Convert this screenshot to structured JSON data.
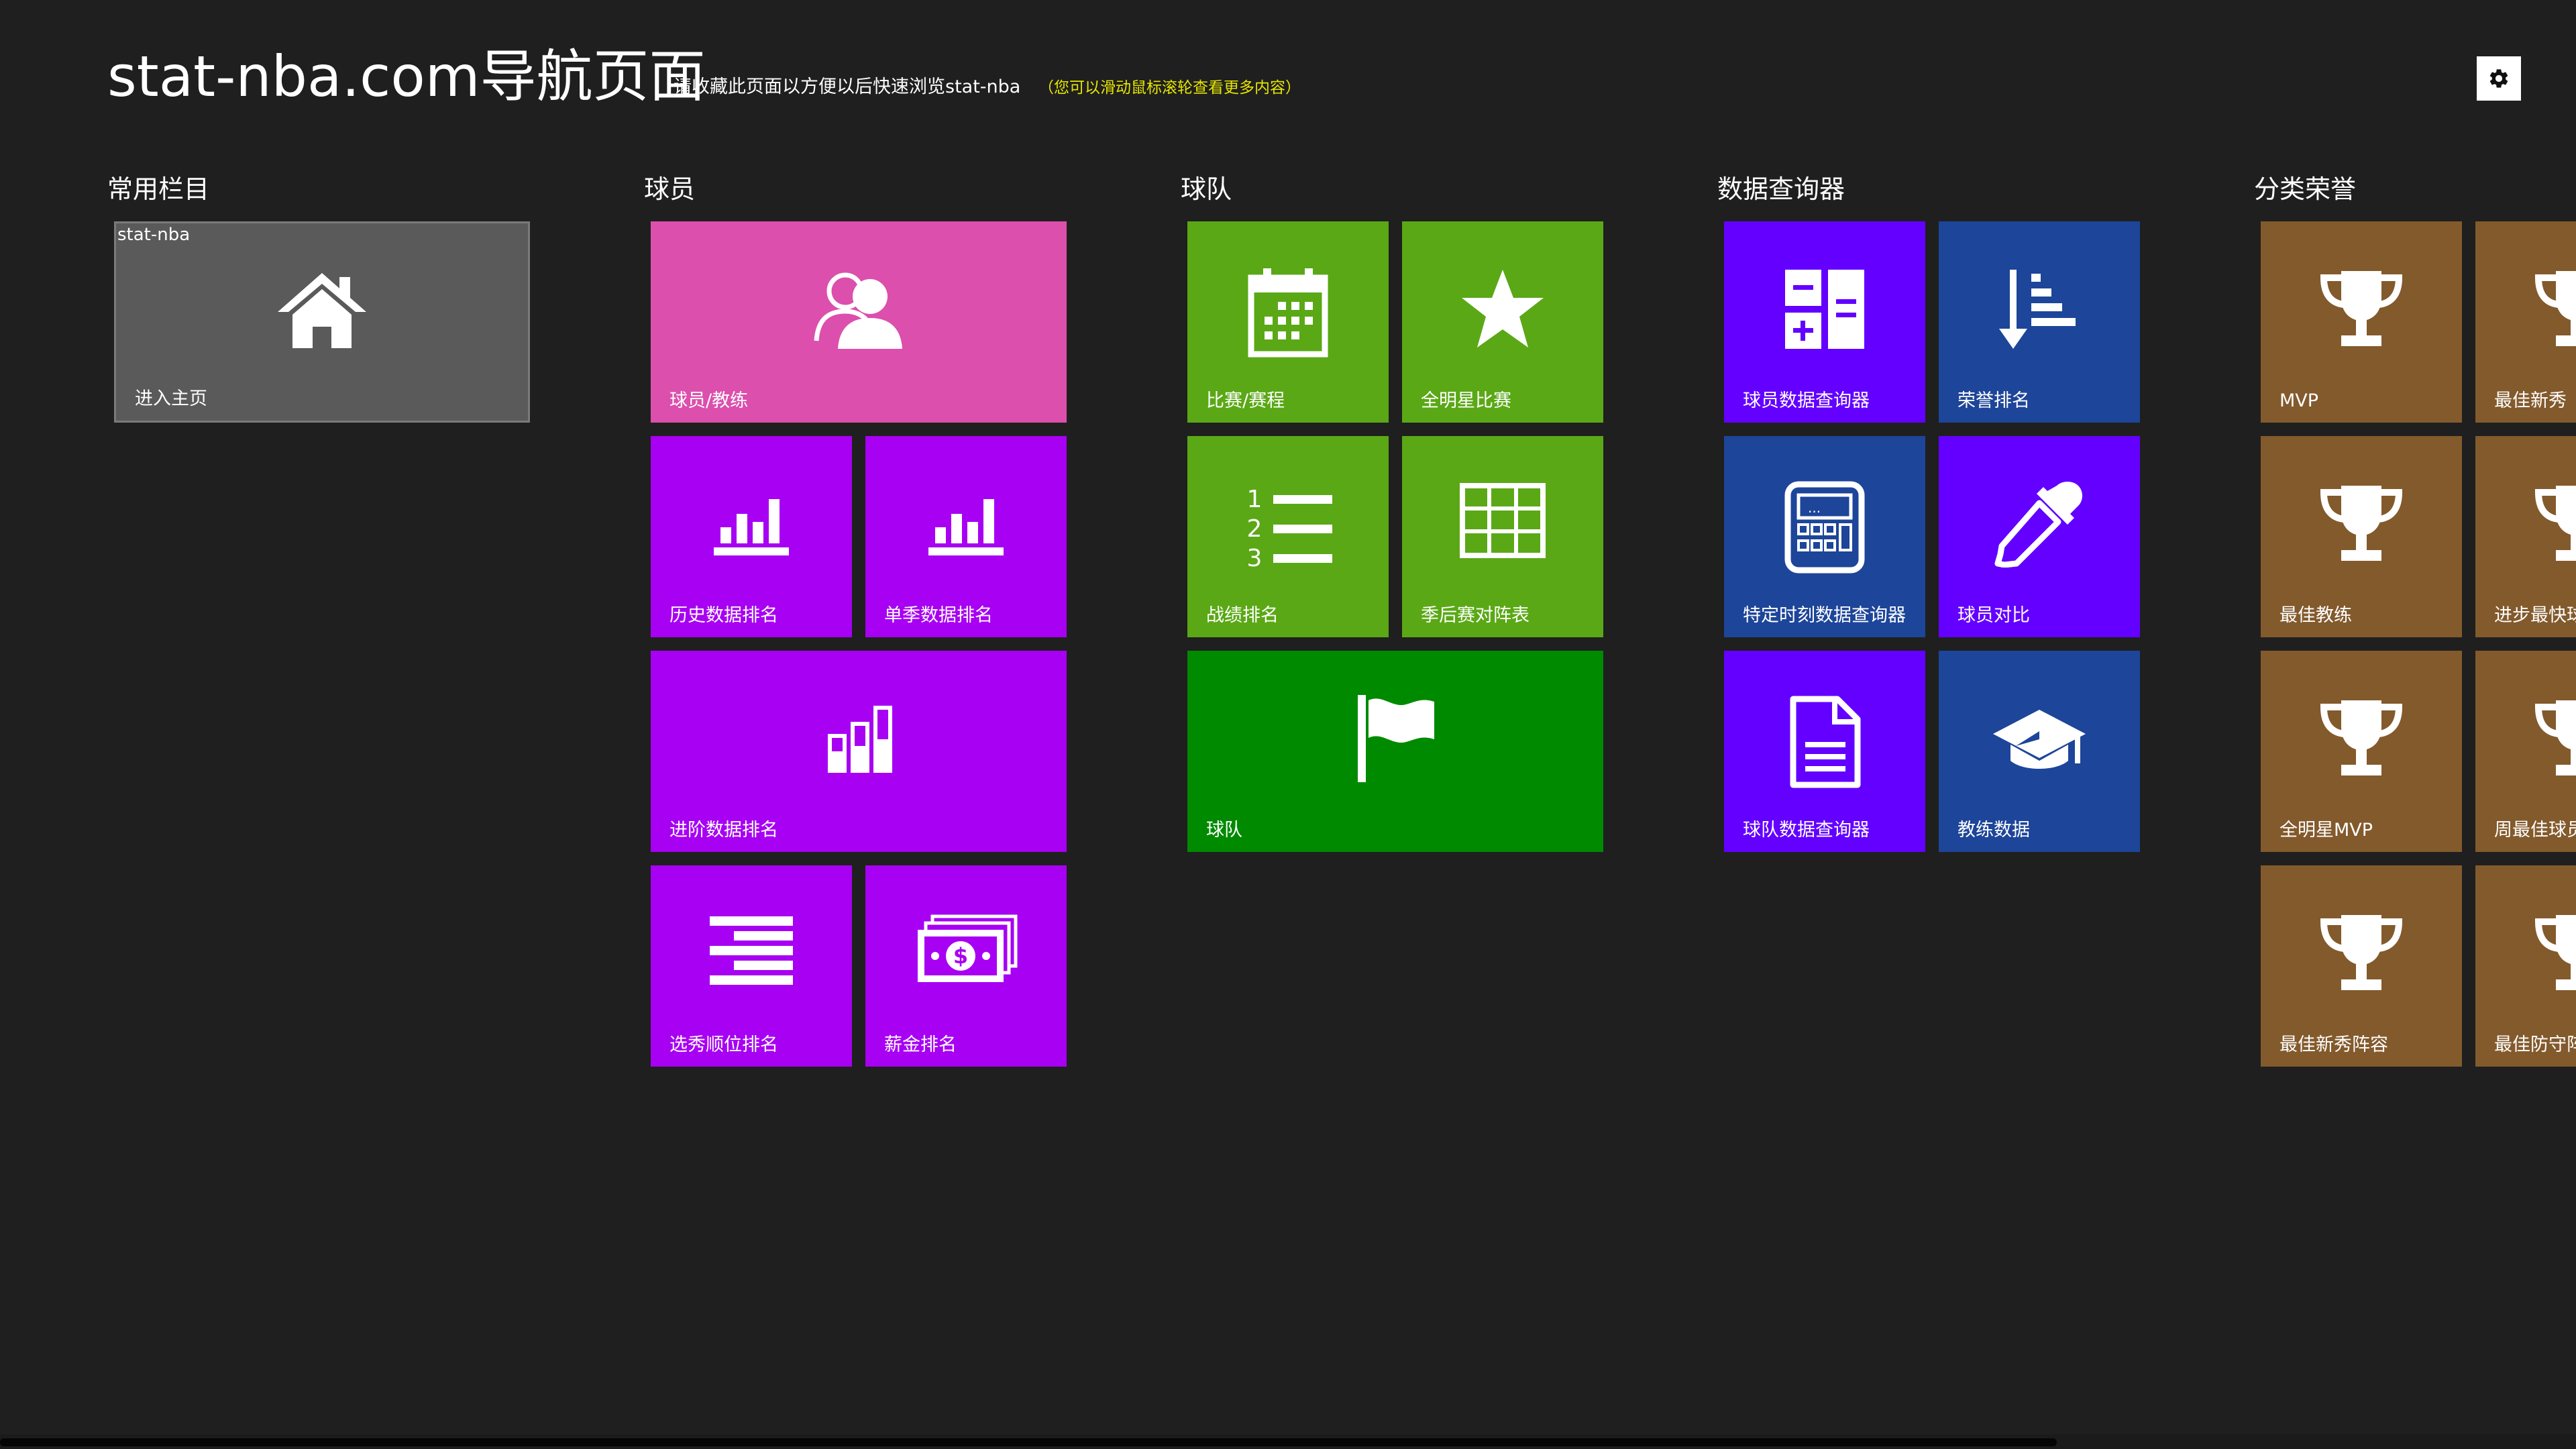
{
  "header": {
    "title": "stat-nba.com导航页面",
    "subtitle": "请收藏此页面以方便以后快速浏览stat-nba",
    "hint": "（您可以滑动鼠标滚轮查看更多内容）"
  },
  "settings": {
    "icon": "gear-icon"
  },
  "colors": {
    "background": "#1f1f1f",
    "gray": "#5a5a5a",
    "pink": "#dc4fad",
    "purple": "#a700f3",
    "green": "#5aa816",
    "dark_green": "#008a00",
    "violet": "#6300ff",
    "blue": "#1d4599",
    "brown": "#835a2c",
    "hint_yellow": "#e6e600"
  },
  "groups": {
    "common": {
      "title": "常用栏目",
      "tiles": {
        "home": {
          "badge": "stat-nba",
          "label": "进入主页",
          "icon": "home-icon"
        }
      }
    },
    "players": {
      "title": "球员",
      "tiles": {
        "players_coaches": {
          "label": "球员/教练",
          "icon": "people-icon"
        },
        "history_rank": {
          "label": "历史数据排名",
          "icon": "bar-chart-icon"
        },
        "season_rank": {
          "label": "单季数据排名",
          "icon": "bar-chart-icon"
        },
        "advanced_rank": {
          "label": "进阶数据排名",
          "icon": "advanced-chart-icon"
        },
        "draft_rank": {
          "label": "选秀顺位排名",
          "icon": "list-lines-icon"
        },
        "salary_rank": {
          "label": "薪金排名",
          "icon": "money-icon"
        }
      }
    },
    "teams": {
      "title": "球队",
      "tiles": {
        "games": {
          "label": "比赛/赛程",
          "icon": "calendar-icon"
        },
        "allstar": {
          "label": "全明星比赛",
          "icon": "star-icon"
        },
        "standings": {
          "label": "战绩排名",
          "icon": "numbered-list-icon"
        },
        "playoffs": {
          "label": "季后赛对阵表",
          "icon": "grid-table-icon"
        },
        "teams": {
          "label": "球队",
          "icon": "flag-icon"
        }
      }
    },
    "query": {
      "title": "数据查询器",
      "tiles": {
        "player_query": {
          "label": "球员数据查询器",
          "icon": "calculator-icon"
        },
        "honor_rank": {
          "label": "荣誉排名",
          "icon": "sort-descending-icon"
        },
        "moment_query": {
          "label": "特定时刻数据查询器",
          "icon": "calculator-screen-icon"
        },
        "player_compare": {
          "label": "球员对比",
          "icon": "eyedropper-icon"
        },
        "team_query": {
          "label": "球队数据查询器",
          "icon": "document-icon"
        },
        "coach_data": {
          "label": "教练数据",
          "icon": "graduation-cap-icon"
        }
      }
    },
    "honors": {
      "title": "分类荣誉",
      "tiles": {
        "mvp": {
          "label": "MVP",
          "icon": "trophy-icon"
        },
        "roy": {
          "label": "最佳新秀",
          "icon": "trophy-icon"
        },
        "coach": {
          "label": "最佳教练",
          "icon": "trophy-icon"
        },
        "mip": {
          "label": "进步最快球员",
          "icon": "trophy-icon"
        },
        "asg_mvp": {
          "label": "全明星MVP",
          "icon": "trophy-icon"
        },
        "pow": {
          "label": "周最佳球员",
          "icon": "trophy-icon"
        },
        "all_rookie": {
          "label": "最佳新秀阵容",
          "icon": "trophy-icon"
        },
        "all_defense": {
          "label": "最佳防守阵容",
          "icon": "trophy-icon"
        }
      }
    }
  }
}
